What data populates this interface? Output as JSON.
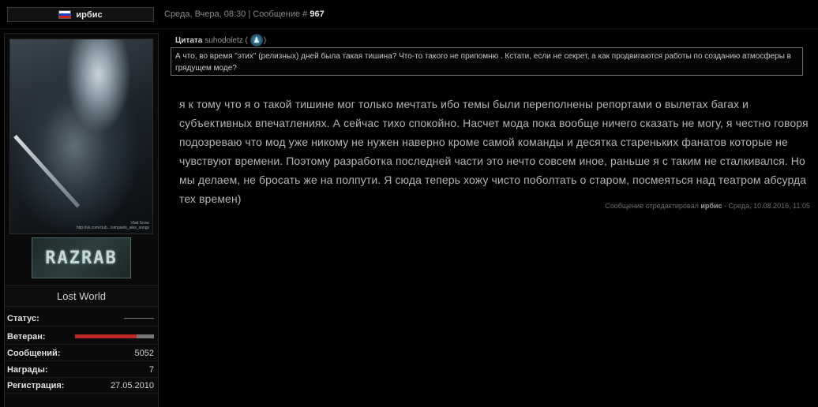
{
  "header": {
    "username": "ирбис",
    "flag_colors": [
      "#ffffff",
      "#1f3fbf",
      "#d22020"
    ],
    "date_text": "Среда, Вчера, 08:30 | Сообщение #",
    "post_number": "967"
  },
  "sidebar": {
    "avatar_caption_line1": "Vlad Scow",
    "avatar_caption_line2": "http://vk.com/club.../simpsets_alex_songs",
    "logo_text": "RAZRAB",
    "group": "Lost World",
    "stats": [
      {
        "label": "Статус:",
        "value": ""
      },
      {
        "label": "Ветеран:",
        "value": ""
      },
      {
        "label": "Сообщений:",
        "value": "5052"
      },
      {
        "label": "Награды:",
        "value": "7"
      },
      {
        "label": "Регистрация:",
        "value": "27.05.2010"
      }
    ],
    "veteran_fraction": 0.78,
    "veteran_color": "#c02828"
  },
  "quote": {
    "label": "Цитата",
    "author": "suhodoletz (",
    "author_close": ")",
    "icon": "user-avatar-icon",
    "text": "А что, во время \"этих\" (релизных) дней была такая тишина? Что-то такого не припомню . Кстати, если не секрет, а как продвигаются работы по созданию атмосферы в грядущем моде?"
  },
  "post": {
    "body": "я к тому что я о такой тишине мог только мечтать ибо темы были переполнены репортами о вылетах багах и субъективных впечатлениях. А сейчас тихо спокойно. Насчет мода пока вообще ничего сказать не могу, я честно говоря подозреваю что мод уже никому не нужен наверно кроме самой команды и десятка старeньких фанатов которые не чувствуют времени. Поэтому разработка последней части это нечто совсем иное, раньше я с таким не сталкивался. Но мы делаем, не бросать же на полпути. Я сюда теперь хожу чисто поболтать о старом, посмеяться над театром абсурда тех времен)",
    "edited_prefix": "Сообщение отредактировал",
    "edited_by": "ирбис",
    "edited_suffix": "- Среда, 10.08.2016, 11:05"
  }
}
